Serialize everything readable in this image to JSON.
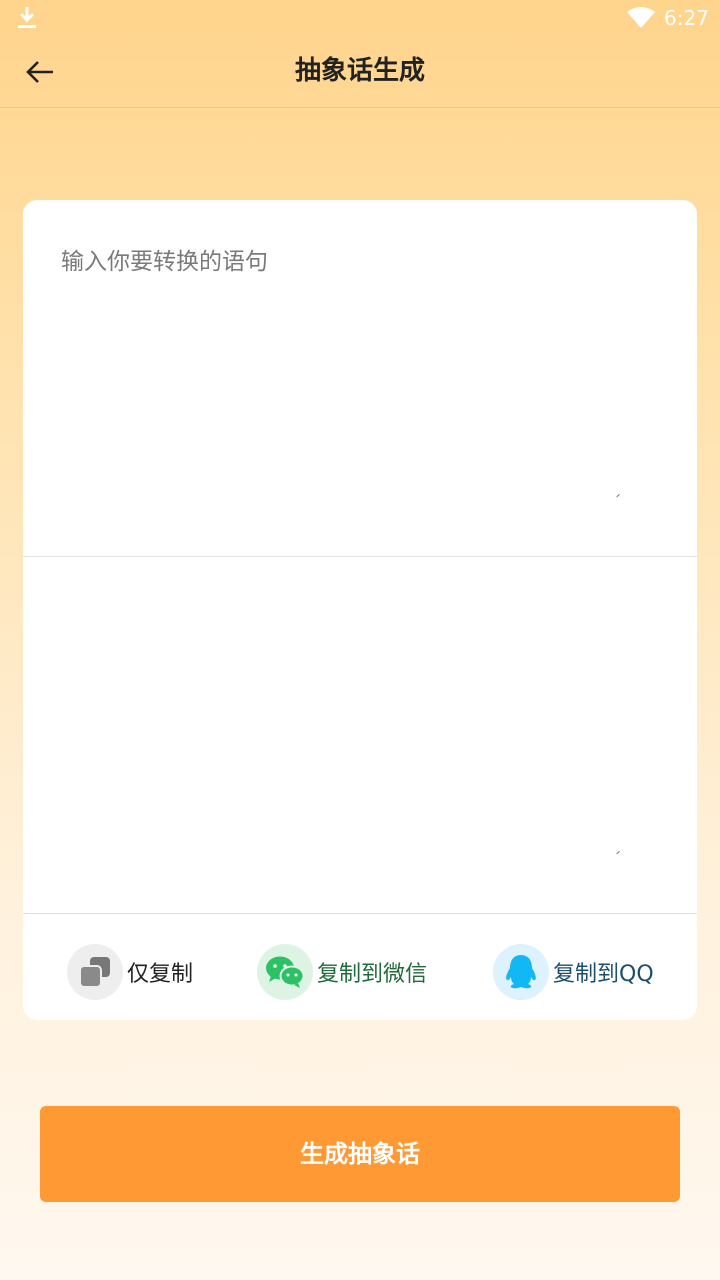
{
  "status_bar": {
    "time": "6:27",
    "download_icon": "download-icon",
    "wifi_icon": "wifi-icon"
  },
  "header": {
    "title": "抽象话生成",
    "back_icon": "back-arrow-icon"
  },
  "input": {
    "placeholder": "输入你要转换的语句",
    "value": ""
  },
  "output": {
    "value": ""
  },
  "actions": {
    "copy": {
      "label": "仅复制",
      "icon": "copy-icon",
      "color": "#222222"
    },
    "wechat": {
      "label": "复制到微信",
      "icon": "wechat-icon",
      "color": "#1F6B3A"
    },
    "qq": {
      "label": "复制到QQ",
      "icon": "qq-icon",
      "color": "#1B4F6E"
    }
  },
  "generate_button": {
    "label": "生成抽象话",
    "color": "#FF9933"
  },
  "colors": {
    "background_top": "#FFD48C",
    "background_bottom": "#FFF8F0",
    "wechat_green": "#2DC166",
    "qq_blue": "#12B7F5"
  }
}
